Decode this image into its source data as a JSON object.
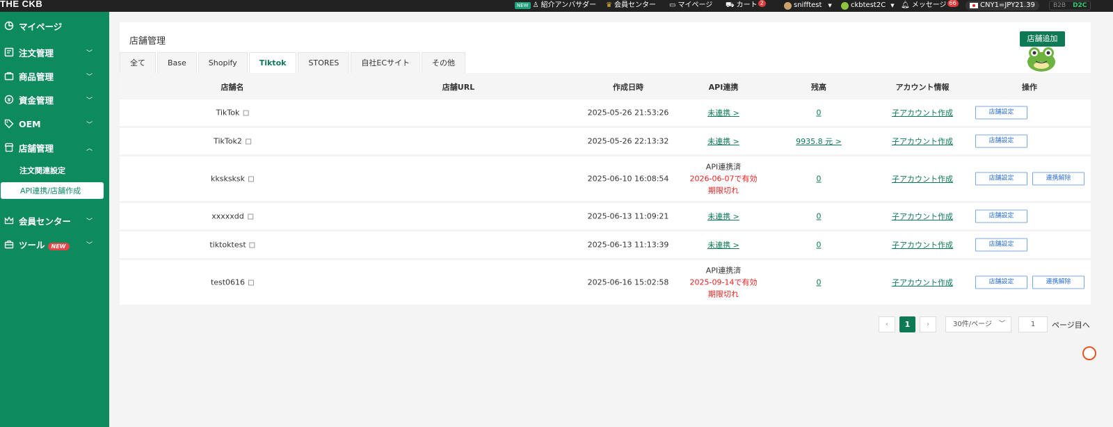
{
  "topbar": {
    "logo": "THE CKB",
    "new_tag": "NEW",
    "ambassador": "紹介アンバサダー",
    "member_center": "会員センター",
    "mypage": "マイページ",
    "cart": "カート",
    "cart_count": "2",
    "user": "snifftest",
    "shop_account": "ckbtest2C",
    "messages": "メッセージ",
    "message_count": "66",
    "currency": "CNY1=JPY21.39",
    "mode_b2b": "B2B",
    "mode_d2c": "D2C"
  },
  "sidebar": {
    "mypage": "マイページ",
    "orders": "注文管理",
    "products": "商品管理",
    "funds": "資金管理",
    "oem": "OEM",
    "stores": "店舗管理",
    "sub_order_settings": "注文関連設定",
    "sub_api": "API連携/店舗作成",
    "member_center": "会員センター",
    "tools": "ツール",
    "tools_new": "NEW"
  },
  "page": {
    "title": "店舗管理",
    "add_button": "店舗追加"
  },
  "tabs": [
    "全て",
    "Base",
    "Shopify",
    "Tiktok",
    "STORES",
    "自社ECサイト",
    "その他"
  ],
  "table": {
    "headers": {
      "name": "店舗名",
      "url": "店舗URL",
      "created": "作成日時",
      "api": "API連携",
      "balance": "残高",
      "account": "アカウント情報",
      "ops": "操作"
    },
    "rows": [
      {
        "name": "TikTok",
        "created": "2025-05-26 21:53:26",
        "api": "未連携 >",
        "balance": "0",
        "account": "子アカウント作成",
        "setting": "店舗設定"
      },
      {
        "name": "TikTok2",
        "created": "2025-05-26 22:13:32",
        "api": "未連携 >",
        "balance": "9935.8 元 >",
        "account": "子アカウント作成",
        "setting": "店舗設定"
      },
      {
        "name": "kksksksk",
        "created": "2025-06-10 16:08:54",
        "api_status": "API連携済",
        "api_valid": "2026-06-07で有効",
        "api_expire": "期限切れ",
        "balance": "0",
        "account": "子アカウント作成",
        "setting": "店舗設定",
        "unlink": "連携解除"
      },
      {
        "name": "xxxxxdd",
        "created": "2025-06-13 11:09:21",
        "api": "未連携 >",
        "balance": "0",
        "account": "子アカウント作成",
        "setting": "店舗設定"
      },
      {
        "name": "tiktoktest",
        "created": "2025-06-13 11:13:39",
        "api": "未連携 >",
        "balance": "0",
        "account": "子アカウント作成",
        "setting": "店舗設定"
      },
      {
        "name": "test0616",
        "created": "2025-06-16 15:02:58",
        "api_status": "API連携済",
        "api_valid": "2025-09-14で有効",
        "api_expire": "期限切れ",
        "balance": "0",
        "account": "子アカウント作成",
        "setting": "店舗設定",
        "unlink": "連携解除"
      }
    ]
  },
  "pagination": {
    "prev": "‹",
    "next": "›",
    "current": "1",
    "page_size": "30件/ページ",
    "goto_value": "1",
    "goto_label": "ページ目へ"
  },
  "colors": {
    "brand_green": "#0e8a5f",
    "link_green": "#0e7a55",
    "expired_red": "#e8231f",
    "button_blue": "#2b6fd6"
  }
}
